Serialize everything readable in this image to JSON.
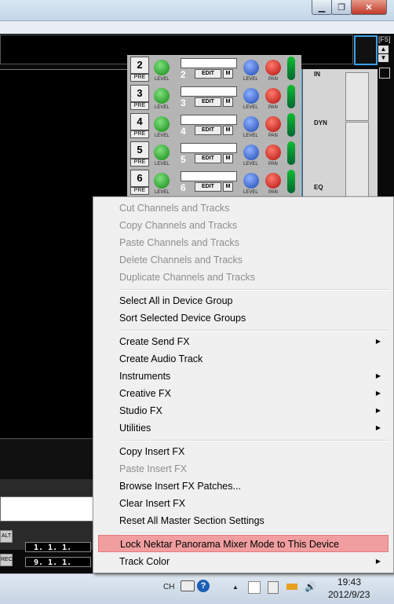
{
  "window": {
    "minimize_icon": "minimize-icon",
    "maximize_icon": "maximize-icon",
    "close_icon": "close-icon",
    "minimize_glyph": "▁",
    "maximize_glyph": "❐",
    "close_glyph": "✕",
    "fs_label": "[F5]"
  },
  "mixer": {
    "channels": [
      {
        "number": "2",
        "number2": "2",
        "pre": "PRE",
        "level": "LEVEL",
        "edit": "EDIT",
        "m": "M",
        "pan": "PAN"
      },
      {
        "number": "3",
        "number2": "3",
        "pre": "PRE",
        "level": "LEVEL",
        "edit": "EDIT",
        "m": "M",
        "pan": "PAN"
      },
      {
        "number": "4",
        "number2": "4",
        "pre": "PRE",
        "level": "LEVEL",
        "edit": "EDIT",
        "m": "M",
        "pan": "PAN"
      },
      {
        "number": "5",
        "number2": "5",
        "pre": "PRE",
        "level": "LEVEL",
        "edit": "EDIT",
        "m": "M",
        "pan": "PAN"
      },
      {
        "number": "6",
        "number2": "6",
        "pre": "PRE",
        "level": "LEVEL",
        "edit": "EDIT",
        "m": "M",
        "pan": "PAN"
      }
    ]
  },
  "rack": {
    "in_label": "IN",
    "dyn_label": "DYN",
    "eq_label": "EQ"
  },
  "transport": {
    "btn1": "ALT",
    "btn2": "REC",
    "pos1": "1. 1. 1.",
    "pos2": "9. 1. 1."
  },
  "context_menu": {
    "items": [
      {
        "label": "Cut Channels and Tracks"
      },
      {
        "label": "Copy Channels and Tracks"
      },
      {
        "label": "Paste Channels and Tracks"
      },
      {
        "label": "Delete Channels and Tracks"
      },
      {
        "label": "Duplicate Channels and Tracks"
      },
      {
        "label": "Select All in Device Group"
      },
      {
        "label": "Sort Selected Device Groups"
      },
      {
        "label": "Create Send FX"
      },
      {
        "label": "Create Audio Track"
      },
      {
        "label": "Instruments"
      },
      {
        "label": "Creative FX"
      },
      {
        "label": "Studio FX"
      },
      {
        "label": "Utilities"
      },
      {
        "label": "Copy Insert FX"
      },
      {
        "label": "Paste Insert FX"
      },
      {
        "label": "Browse Insert FX Patches..."
      },
      {
        "label": "Clear Insert FX"
      },
      {
        "label": "Reset All Master Section Settings"
      },
      {
        "label": "Lock Nektar Panorama Mixer Mode to This Device"
      },
      {
        "label": "Track Color"
      }
    ],
    "submenu_arrow": "▶"
  },
  "taskbar": {
    "lang": "CH",
    "time": "19:43",
    "date": "2012/9/23",
    "keyboard_icon": "keyboard-icon",
    "help_icon": "help-icon",
    "show_hidden_icon": "show-hidden-icons-icon",
    "flag_icon": "action-center-flag-icon",
    "network_icon": "network-icon",
    "power_icon": "power-icon",
    "volume_icon": "volume-icon",
    "help_glyph": "?",
    "up_glyph": "▲",
    "volume_glyph": "🔊"
  }
}
